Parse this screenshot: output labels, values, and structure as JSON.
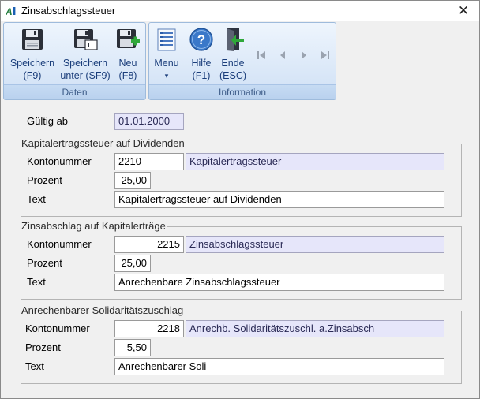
{
  "window": {
    "title": "Zinsabschlagssteuer",
    "close_symbol": "✕"
  },
  "ribbon": {
    "groups": {
      "daten": "Daten",
      "information": "Information"
    },
    "buttons": {
      "speichern": {
        "line1": "Speichern",
        "line2": "(F9)",
        "icon": "floppy-disk-icon"
      },
      "speichern_unter": {
        "line1": "Speichern",
        "line2": "unter (SF9)",
        "icon": "floppy-disk-save-as-icon"
      },
      "neu": {
        "line1": "Neu",
        "line2": "(F8)",
        "icon": "floppy-disk-new-icon"
      },
      "menu": {
        "line1": "Menu",
        "line2": "▾",
        "icon": "menu-list-icon"
      },
      "hilfe": {
        "line1": "Hilfe",
        "line2": "(F1)",
        "icon": "help-icon"
      },
      "ende": {
        "line1": "Ende",
        "line2": "(ESC)",
        "icon": "exit-door-icon"
      }
    },
    "navigation": [
      "first-record-icon",
      "previous-record-icon",
      "next-record-icon",
      "last-record-icon"
    ]
  },
  "form": {
    "gueltig_ab": {
      "label": "Gültig ab",
      "value": "01.01.2000"
    },
    "sections": [
      {
        "title": "Kapitalertragssteuer auf Dividenden",
        "kontonummer_label": "Kontonummer",
        "kontonummer": "2210",
        "konto_name": "Kapitalertragssteuer",
        "prozent_label": "Prozent",
        "prozent": "25,00",
        "text_label": "Text",
        "text": "Kapitalertragssteuer auf Dividenden"
      },
      {
        "title": "Zinsabschlag auf Kapitalerträge",
        "kontonummer_label": "Kontonummer",
        "kontonummer": "2215",
        "konto_name": "Zinsabschlagssteuer",
        "prozent_label": "Prozent",
        "prozent": "25,00",
        "text_label": "Text",
        "text": "Anrechenbare Zinsabschlagssteuer"
      },
      {
        "title": "Anrechenbarer Solidaritätszuschlag",
        "kontonummer_label": "Kontonummer",
        "kontonummer": "2218",
        "konto_name": "Anrechb. Solidaritätszuschl. a.Zinsabsch",
        "prozent_label": "Prozent",
        "prozent": "5,50",
        "text_label": "Text",
        "text": "Anrechenbarer Soli"
      }
    ]
  }
}
